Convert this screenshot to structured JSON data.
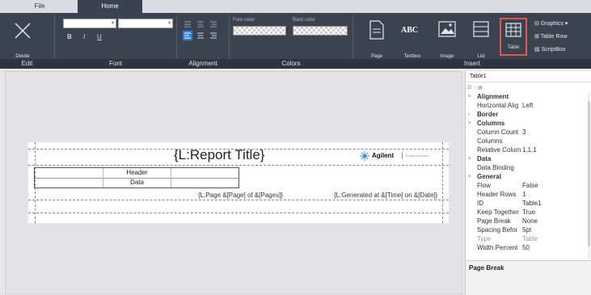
{
  "tabs": [
    {
      "label": "File"
    },
    {
      "label": "Home"
    }
  ],
  "ribbon": {
    "groups": [
      {
        "label": "Edit"
      },
      {
        "label": "Font"
      },
      {
        "label": "Alignment"
      },
      {
        "label": "Colors"
      },
      {
        "label": "Insert"
      }
    ],
    "edit": {
      "delete_label": "Delete",
      "icon": "close-x-icon"
    },
    "font": {
      "bold": "B",
      "italic": "I",
      "underline": "U"
    },
    "colors": {
      "fore_label": "Fore color",
      "back_label": "Back color"
    },
    "insert": {
      "page_label": "Page",
      "textbox_label": "Textbox",
      "textbox_glyph": "ABC",
      "image_label": "Image",
      "list_label": "List",
      "table_label": "Table",
      "graphics_label": "Graphics",
      "table_row_label": "Table Row",
      "scriptbox_label": "ScriptBox"
    }
  },
  "report": {
    "title": "{L:Report Title}",
    "logo_text": "Agilent",
    "logo_tagline": "Trusted Answers",
    "table_header": "Header",
    "table_data": "Data",
    "page_text": "{L:Page &[Page] of &[Pages]}",
    "generated_text": "{L:Generated at &[Time] on &[Date]}"
  },
  "properties": {
    "object_name": "Table1",
    "rows": [
      {
        "type": "cat",
        "name": "Alignment"
      },
      {
        "type": "prop",
        "name": "Horizontal Alig",
        "value": "Left"
      },
      {
        "type": "cat",
        "name": "Border",
        "collapsed": true
      },
      {
        "type": "cat",
        "name": "Columns"
      },
      {
        "type": "prop",
        "name": "Column Count",
        "value": "3"
      },
      {
        "type": "prop",
        "name": "Columns",
        "value": ""
      },
      {
        "type": "prop",
        "name": "Relative Colum",
        "value": "1,1,1"
      },
      {
        "type": "cat",
        "name": "Data"
      },
      {
        "type": "prop",
        "name": "Data Binding",
        "value": ""
      },
      {
        "type": "cat",
        "name": "General"
      },
      {
        "type": "prop",
        "name": "Flow",
        "value": "False"
      },
      {
        "type": "prop",
        "name": "Header Rows",
        "value": "1"
      },
      {
        "type": "prop",
        "name": "ID",
        "value": "Table1"
      },
      {
        "type": "prop",
        "name": "Keep Together",
        "value": "True"
      },
      {
        "type": "prop",
        "name": "Page Break",
        "value": "None"
      },
      {
        "type": "prop",
        "name": "Spacing Befor",
        "value": "5pt"
      },
      {
        "type": "prop",
        "name": "Type",
        "value": "Table",
        "dim": true
      },
      {
        "type": "prop",
        "name": "Width Percent",
        "value": "50"
      }
    ],
    "description_title": "Page Break"
  },
  "colors": {
    "ribbon_bg": "#3c4350",
    "active_tab": "#3a4250",
    "highlight": "#e05a4a",
    "align_active": "#2f7fd6"
  }
}
